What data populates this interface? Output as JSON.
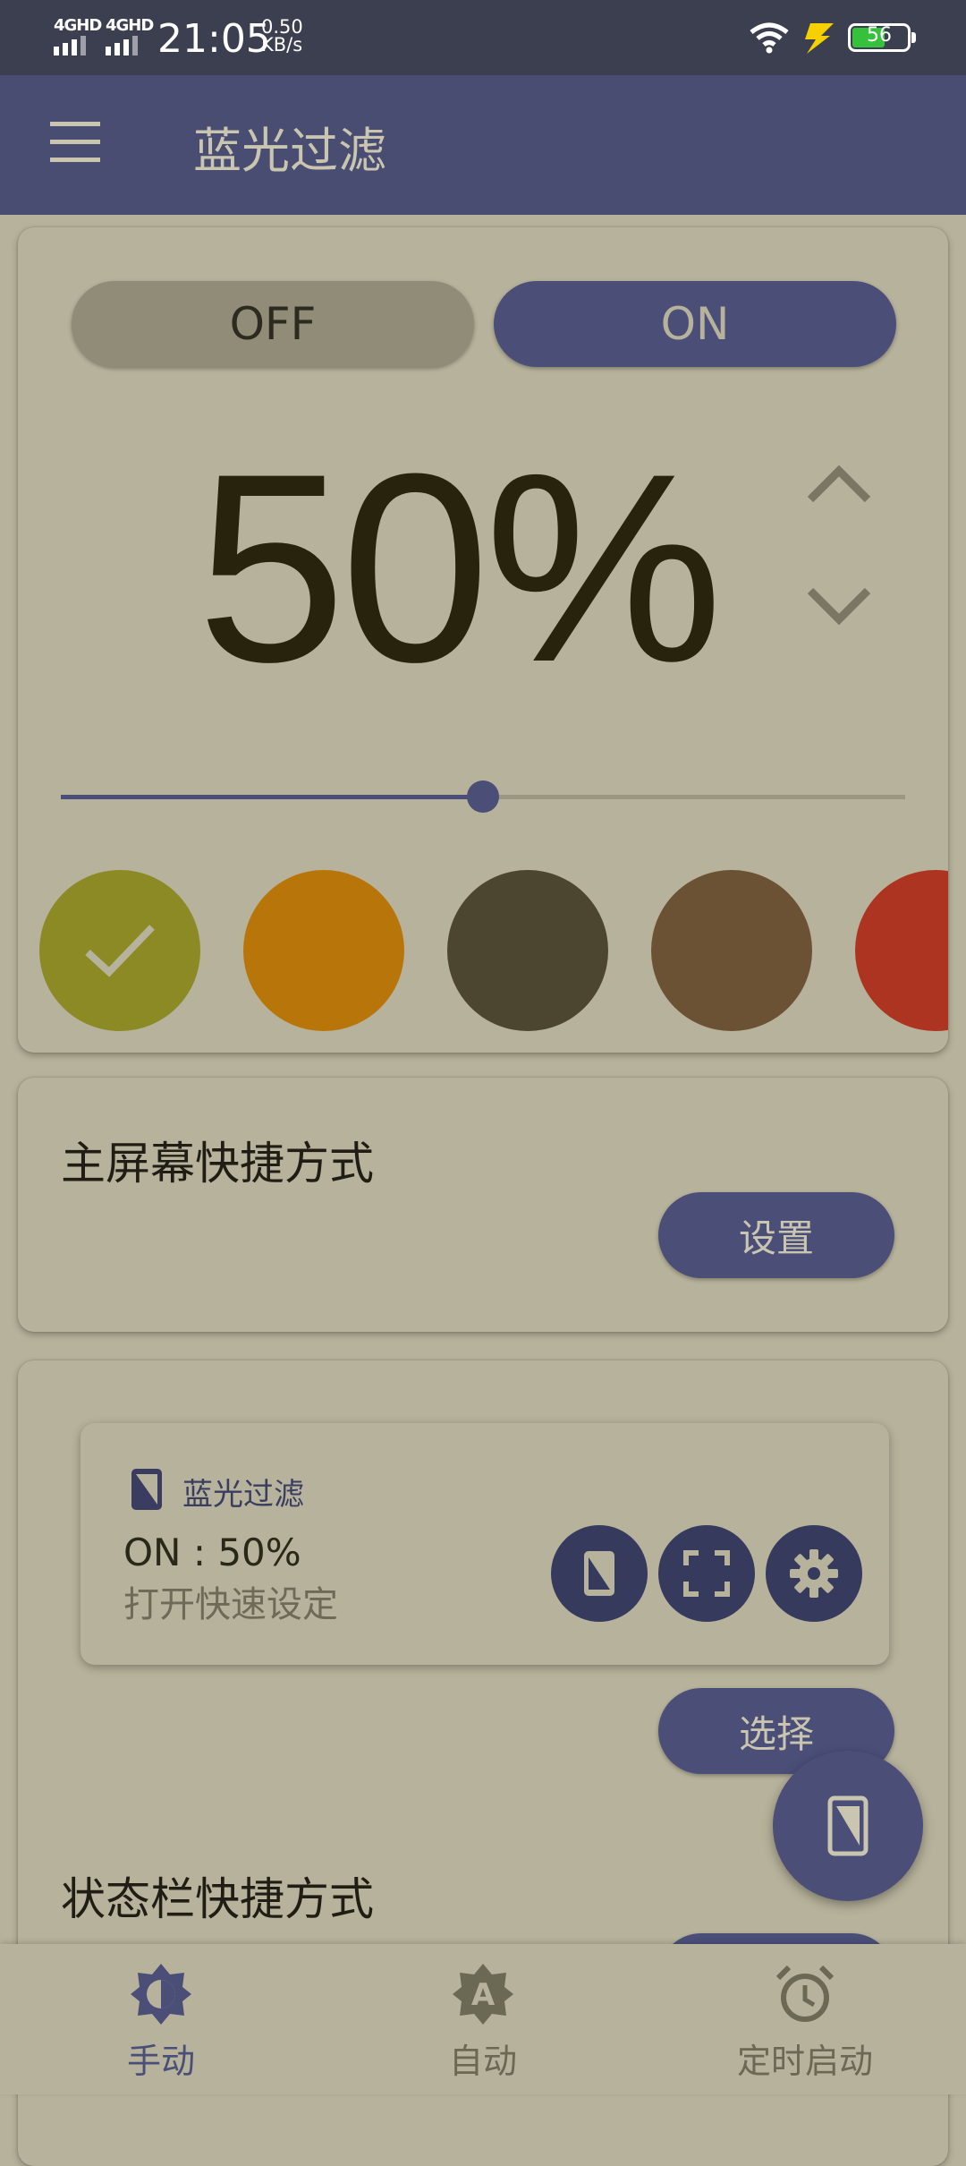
{
  "status_bar": {
    "network1": "4GHD",
    "network2": "4GHD",
    "time": "21:05",
    "speed_value": "0.50",
    "speed_unit": "KB/s",
    "battery": "56",
    "battery_color": "#35c13b"
  },
  "app_bar": {
    "title": "蓝光过滤",
    "menu_icon": "hamburger-menu-icon",
    "color": "#484d71"
  },
  "filter": {
    "off_label": "OFF",
    "on_label": "ON",
    "state": "ON",
    "percent_text": "50%",
    "intensity": 0.5,
    "up_icon": "chevron-up-icon",
    "down_icon": "chevron-down-icon"
  },
  "colors": [
    {
      "hex": "#8b8a24",
      "selected": true
    },
    {
      "hex": "#b8760a"
    },
    {
      "hex": "#4c4530"
    },
    {
      "hex": "#6b5234"
    },
    {
      "hex": "#ad3421"
    }
  ],
  "home_shortcut": {
    "title": "主屏幕快捷方式",
    "button": "设置"
  },
  "notification": {
    "app_name": "蓝光过滤",
    "state": "ON : 50%",
    "subtitle": "打开快速设定",
    "action_icons": [
      "phone-filter-icon",
      "fullscreen-icon",
      "gear-icon"
    ]
  },
  "notification_select_button": "选择",
  "statusbar_shortcut": {
    "title": "状态栏快捷方式"
  },
  "bottom_nav": {
    "items": [
      {
        "label": "手动",
        "icon": "brightness-icon",
        "active": true
      },
      {
        "label": "自动",
        "icon": "auto-brightness-icon",
        "active": false
      },
      {
        "label": "定时启动",
        "icon": "alarm-clock-icon",
        "active": false
      }
    ]
  }
}
